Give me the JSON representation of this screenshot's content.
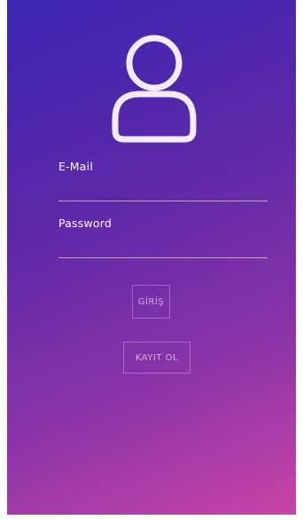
{
  "login": {
    "avatar_icon": "user-profile-icon",
    "email": {
      "label": "E-Mail",
      "value": ""
    },
    "password": {
      "label": "Password",
      "value": ""
    },
    "buttons": {
      "login_label": "GİRİŞ",
      "register_label": "KAYIT OL"
    }
  },
  "colors": {
    "gradient_top": "#3a26b3",
    "gradient_mid": "#8a34a8",
    "gradient_bottom": "#c944a6",
    "foreground": "#ffffff"
  }
}
